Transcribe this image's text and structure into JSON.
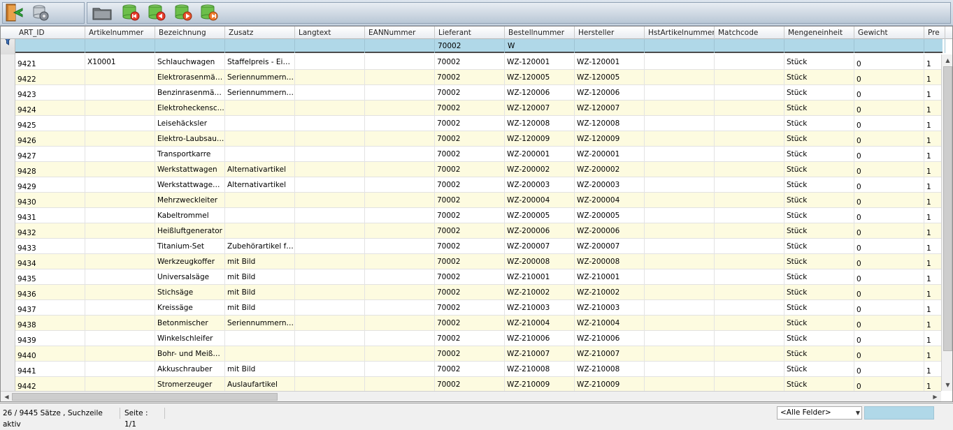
{
  "toolbar": {
    "icons": [
      "exit-door-icon",
      "database-settings-icon",
      "folder-icon",
      "first-record-icon",
      "previous-record-icon",
      "next-record-icon",
      "last-record-icon"
    ]
  },
  "grid": {
    "columns": [
      "ART_ID",
      "Artikelnummer",
      "Bezeichnung",
      "Zusatz",
      "Langtext",
      "EANNummer",
      "Lieferant",
      "Bestellnummer",
      "Hersteller",
      "HstArtikelnummer",
      "Matchcode",
      "Mengeneinheit",
      "Gewicht",
      "Pre"
    ],
    "filters": [
      "",
      "",
      "",
      "",
      "",
      "",
      "70002",
      "W",
      "",
      "",
      "",
      "",
      "",
      ""
    ],
    "rows": [
      {
        "art_id": "9421",
        "artnr": "X10001",
        "bez": "Schlauchwagen",
        "zusatz": "Staffelpreis - Eink...",
        "langtext": "",
        "ean": "",
        "lieferant": "70002",
        "bestellnr": "WZ-120001",
        "hersteller": "WZ-120001",
        "hstnr": "",
        "matchcode": "",
        "einheit": "Stück",
        "gewicht": "0",
        "pre": "1"
      },
      {
        "art_id": "9422",
        "artnr": "",
        "bez": "Elektrorasenmäher",
        "zusatz": "Seriennummernar...",
        "langtext": "",
        "ean": "",
        "lieferant": "70002",
        "bestellnr": "WZ-120005",
        "hersteller": "WZ-120005",
        "hstnr": "",
        "matchcode": "",
        "einheit": "Stück",
        "gewicht": "0",
        "pre": "1"
      },
      {
        "art_id": "9423",
        "artnr": "",
        "bez": "Benzinrasenmäher",
        "zusatz": "Seriennummernar...",
        "langtext": "",
        "ean": "",
        "lieferant": "70002",
        "bestellnr": "WZ-120006",
        "hersteller": "WZ-120006",
        "hstnr": "",
        "matchcode": "",
        "einheit": "Stück",
        "gewicht": "0",
        "pre": "1"
      },
      {
        "art_id": "9424",
        "artnr": "",
        "bez": "Elektroheckensc...",
        "zusatz": "",
        "langtext": "",
        "ean": "",
        "lieferant": "70002",
        "bestellnr": "WZ-120007",
        "hersteller": "WZ-120007",
        "hstnr": "",
        "matchcode": "",
        "einheit": "Stück",
        "gewicht": "0",
        "pre": "1"
      },
      {
        "art_id": "9425",
        "artnr": "",
        "bez": "Leisehäcksler",
        "zusatz": "",
        "langtext": "",
        "ean": "",
        "lieferant": "70002",
        "bestellnr": "WZ-120008",
        "hersteller": "WZ-120008",
        "hstnr": "",
        "matchcode": "",
        "einheit": "Stück",
        "gewicht": "0",
        "pre": "1"
      },
      {
        "art_id": "9426",
        "artnr": "",
        "bez": "Elektro-Laubsauger",
        "zusatz": "",
        "langtext": "",
        "ean": "",
        "lieferant": "70002",
        "bestellnr": "WZ-120009",
        "hersteller": "WZ-120009",
        "hstnr": "",
        "matchcode": "",
        "einheit": "Stück",
        "gewicht": "0",
        "pre": "1"
      },
      {
        "art_id": "9427",
        "artnr": "",
        "bez": "Transportkarre",
        "zusatz": "",
        "langtext": "",
        "ean": "",
        "lieferant": "70002",
        "bestellnr": "WZ-200001",
        "hersteller": "WZ-200001",
        "hstnr": "",
        "matchcode": "",
        "einheit": "Stück",
        "gewicht": "0",
        "pre": "1"
      },
      {
        "art_id": "9428",
        "artnr": "",
        "bez": "Werkstattwagen",
        "zusatz": "Alternativartikel",
        "langtext": "",
        "ean": "",
        "lieferant": "70002",
        "bestellnr": "WZ-200002",
        "hersteller": "WZ-200002",
        "hstnr": "",
        "matchcode": "",
        "einheit": "Stück",
        "gewicht": "0",
        "pre": "1"
      },
      {
        "art_id": "9429",
        "artnr": "",
        "bez": "Werkstattwagen ...",
        "zusatz": "Alternativartikel",
        "langtext": "",
        "ean": "",
        "lieferant": "70002",
        "bestellnr": "WZ-200003",
        "hersteller": "WZ-200003",
        "hstnr": "",
        "matchcode": "",
        "einheit": "Stück",
        "gewicht": "0",
        "pre": "1"
      },
      {
        "art_id": "9430",
        "artnr": "",
        "bez": "Mehrzweckleiter",
        "zusatz": "",
        "langtext": "",
        "ean": "",
        "lieferant": "70002",
        "bestellnr": "WZ-200004",
        "hersteller": "WZ-200004",
        "hstnr": "",
        "matchcode": "",
        "einheit": "Stück",
        "gewicht": "0",
        "pre": "1"
      },
      {
        "art_id": "9431",
        "artnr": "",
        "bez": "Kabeltrommel",
        "zusatz": "",
        "langtext": "",
        "ean": "",
        "lieferant": "70002",
        "bestellnr": "WZ-200005",
        "hersteller": "WZ-200005",
        "hstnr": "",
        "matchcode": "",
        "einheit": "Stück",
        "gewicht": "0",
        "pre": "1"
      },
      {
        "art_id": "9432",
        "artnr": "",
        "bez": "Heißluftgenerator",
        "zusatz": "",
        "langtext": "",
        "ean": "",
        "lieferant": "70002",
        "bestellnr": "WZ-200006",
        "hersteller": "WZ-200006",
        "hstnr": "",
        "matchcode": "",
        "einheit": "Stück",
        "gewicht": "0",
        "pre": "1"
      },
      {
        "art_id": "9433",
        "artnr": "",
        "bez": "Titanium-Set",
        "zusatz": "Zubehörartikel für...",
        "langtext": "",
        "ean": "",
        "lieferant": "70002",
        "bestellnr": "WZ-200007",
        "hersteller": "WZ-200007",
        "hstnr": "",
        "matchcode": "",
        "einheit": "Stück",
        "gewicht": "0",
        "pre": "1"
      },
      {
        "art_id": "9434",
        "artnr": "",
        "bez": "Werkzeugkoffer",
        "zusatz": "mit Bild",
        "langtext": "",
        "ean": "",
        "lieferant": "70002",
        "bestellnr": "WZ-200008",
        "hersteller": "WZ-200008",
        "hstnr": "",
        "matchcode": "",
        "einheit": "Stück",
        "gewicht": "0",
        "pre": "1"
      },
      {
        "art_id": "9435",
        "artnr": "",
        "bez": "Universalsäge",
        "zusatz": "mit Bild",
        "langtext": "",
        "ean": "",
        "lieferant": "70002",
        "bestellnr": "WZ-210001",
        "hersteller": "WZ-210001",
        "hstnr": "",
        "matchcode": "",
        "einheit": "Stück",
        "gewicht": "0",
        "pre": "1"
      },
      {
        "art_id": "9436",
        "artnr": "",
        "bez": "Stichsäge",
        "zusatz": "mit Bild",
        "langtext": "",
        "ean": "",
        "lieferant": "70002",
        "bestellnr": "WZ-210002",
        "hersteller": "WZ-210002",
        "hstnr": "",
        "matchcode": "",
        "einheit": "Stück",
        "gewicht": "0",
        "pre": "1"
      },
      {
        "art_id": "9437",
        "artnr": "",
        "bez": "Kreissäge",
        "zusatz": "mit Bild",
        "langtext": "",
        "ean": "",
        "lieferant": "70002",
        "bestellnr": "WZ-210003",
        "hersteller": "WZ-210003",
        "hstnr": "",
        "matchcode": "",
        "einheit": "Stück",
        "gewicht": "0",
        "pre": "1"
      },
      {
        "art_id": "9438",
        "artnr": "",
        "bez": "Betonmischer",
        "zusatz": "Seriennummern i...",
        "langtext": "",
        "ean": "",
        "lieferant": "70002",
        "bestellnr": "WZ-210004",
        "hersteller": "WZ-210004",
        "hstnr": "",
        "matchcode": "",
        "einheit": "Stück",
        "gewicht": "0",
        "pre": "1"
      },
      {
        "art_id": "9439",
        "artnr": "",
        "bez": "Winkelschleifer",
        "zusatz": "",
        "langtext": "",
        "ean": "",
        "lieferant": "70002",
        "bestellnr": "WZ-210006",
        "hersteller": "WZ-210006",
        "hstnr": "",
        "matchcode": "",
        "einheit": "Stück",
        "gewicht": "0",
        "pre": "1"
      },
      {
        "art_id": "9440",
        "artnr": "",
        "bez": "Bohr- und Meißel...",
        "zusatz": "",
        "langtext": "",
        "ean": "",
        "lieferant": "70002",
        "bestellnr": "WZ-210007",
        "hersteller": "WZ-210007",
        "hstnr": "",
        "matchcode": "",
        "einheit": "Stück",
        "gewicht": "0",
        "pre": "1"
      },
      {
        "art_id": "9441",
        "artnr": "",
        "bez": "Akkuschrauber",
        "zusatz": "mit Bild",
        "langtext": "",
        "ean": "",
        "lieferant": "70002",
        "bestellnr": "WZ-210008",
        "hersteller": "WZ-210008",
        "hstnr": "",
        "matchcode": "",
        "einheit": "Stück",
        "gewicht": "0",
        "pre": "1"
      },
      {
        "art_id": "9442",
        "artnr": "",
        "bez": "Stromerzeuger",
        "zusatz": "Auslaufartikel",
        "langtext": "",
        "ean": "",
        "lieferant": "70002",
        "bestellnr": "WZ-210009",
        "hersteller": "WZ-210009",
        "hstnr": "",
        "matchcode": "",
        "einheit": "Stück",
        "gewicht": "0",
        "pre": "1"
      }
    ]
  },
  "status": {
    "record_count": "26 / 9445 Sätze , Suchzeile aktiv",
    "page": "Seite : 1/1",
    "field_select": "<Alle Felder>"
  },
  "colors": {
    "search_row": "#b0d8e8",
    "row_alt": "#fdfbe0"
  }
}
